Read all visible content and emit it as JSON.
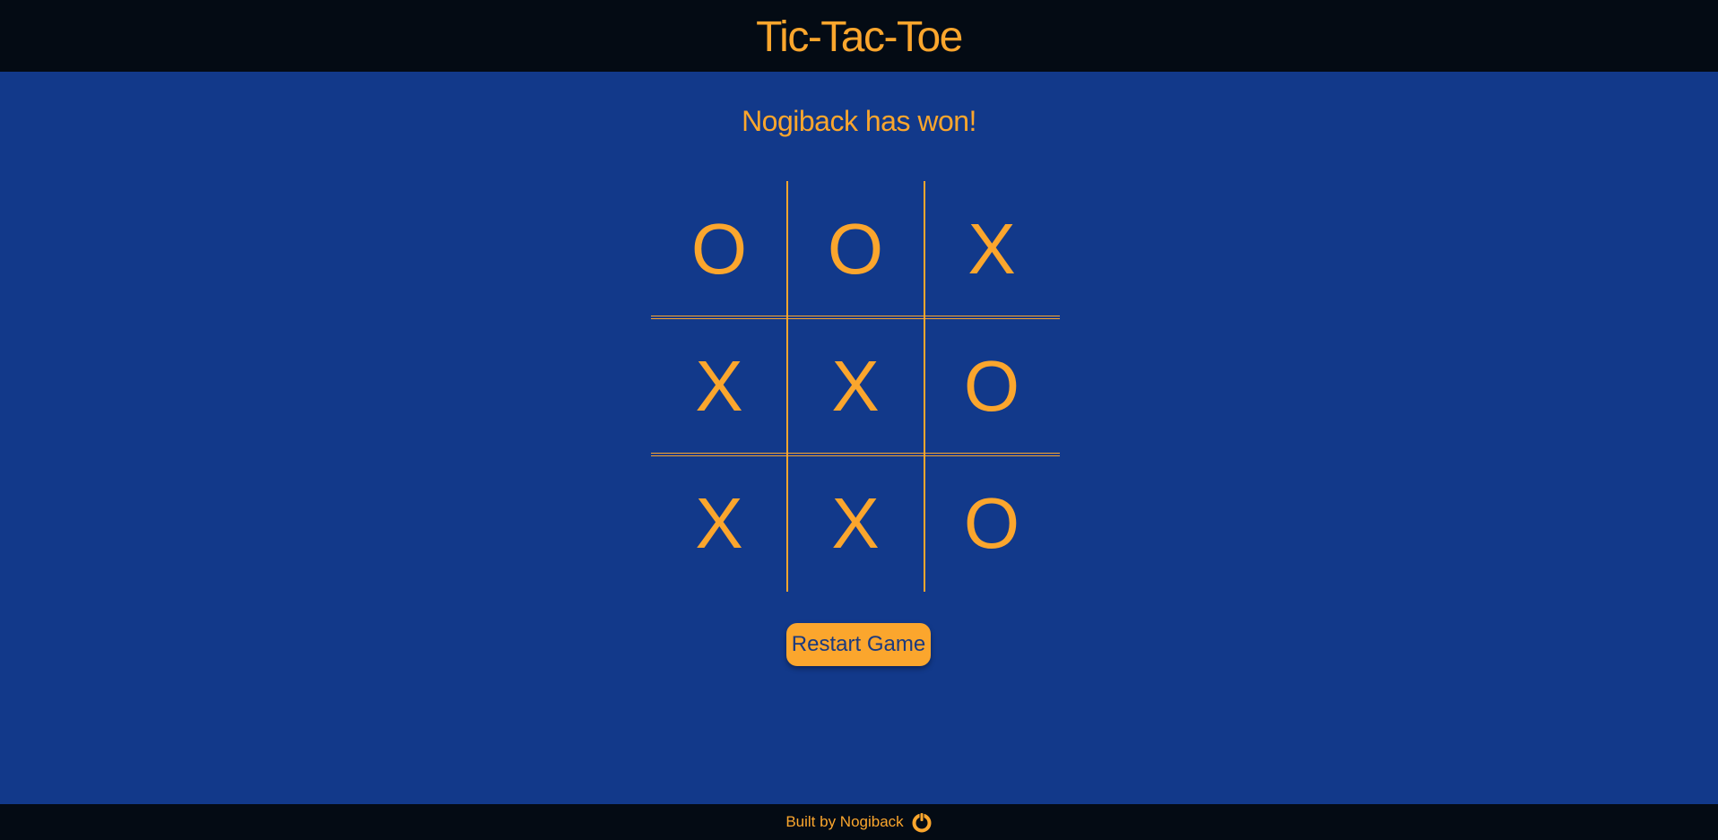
{
  "header": {
    "title": "Tic-Tac-Toe"
  },
  "status": "Nogiback has won!",
  "board": {
    "cells": [
      "O",
      "O",
      "X",
      "X",
      "X",
      "O",
      "X",
      "X",
      "O"
    ]
  },
  "controls": {
    "restart_label": "Restart Game"
  },
  "footer": {
    "credit": "Built by Nogiback",
    "logo_icon": "power-ring-icon"
  },
  "colors": {
    "accent": "#fba62d",
    "background": "#12398a",
    "bar": "#040b14",
    "button_text": "#1b3a7f"
  }
}
